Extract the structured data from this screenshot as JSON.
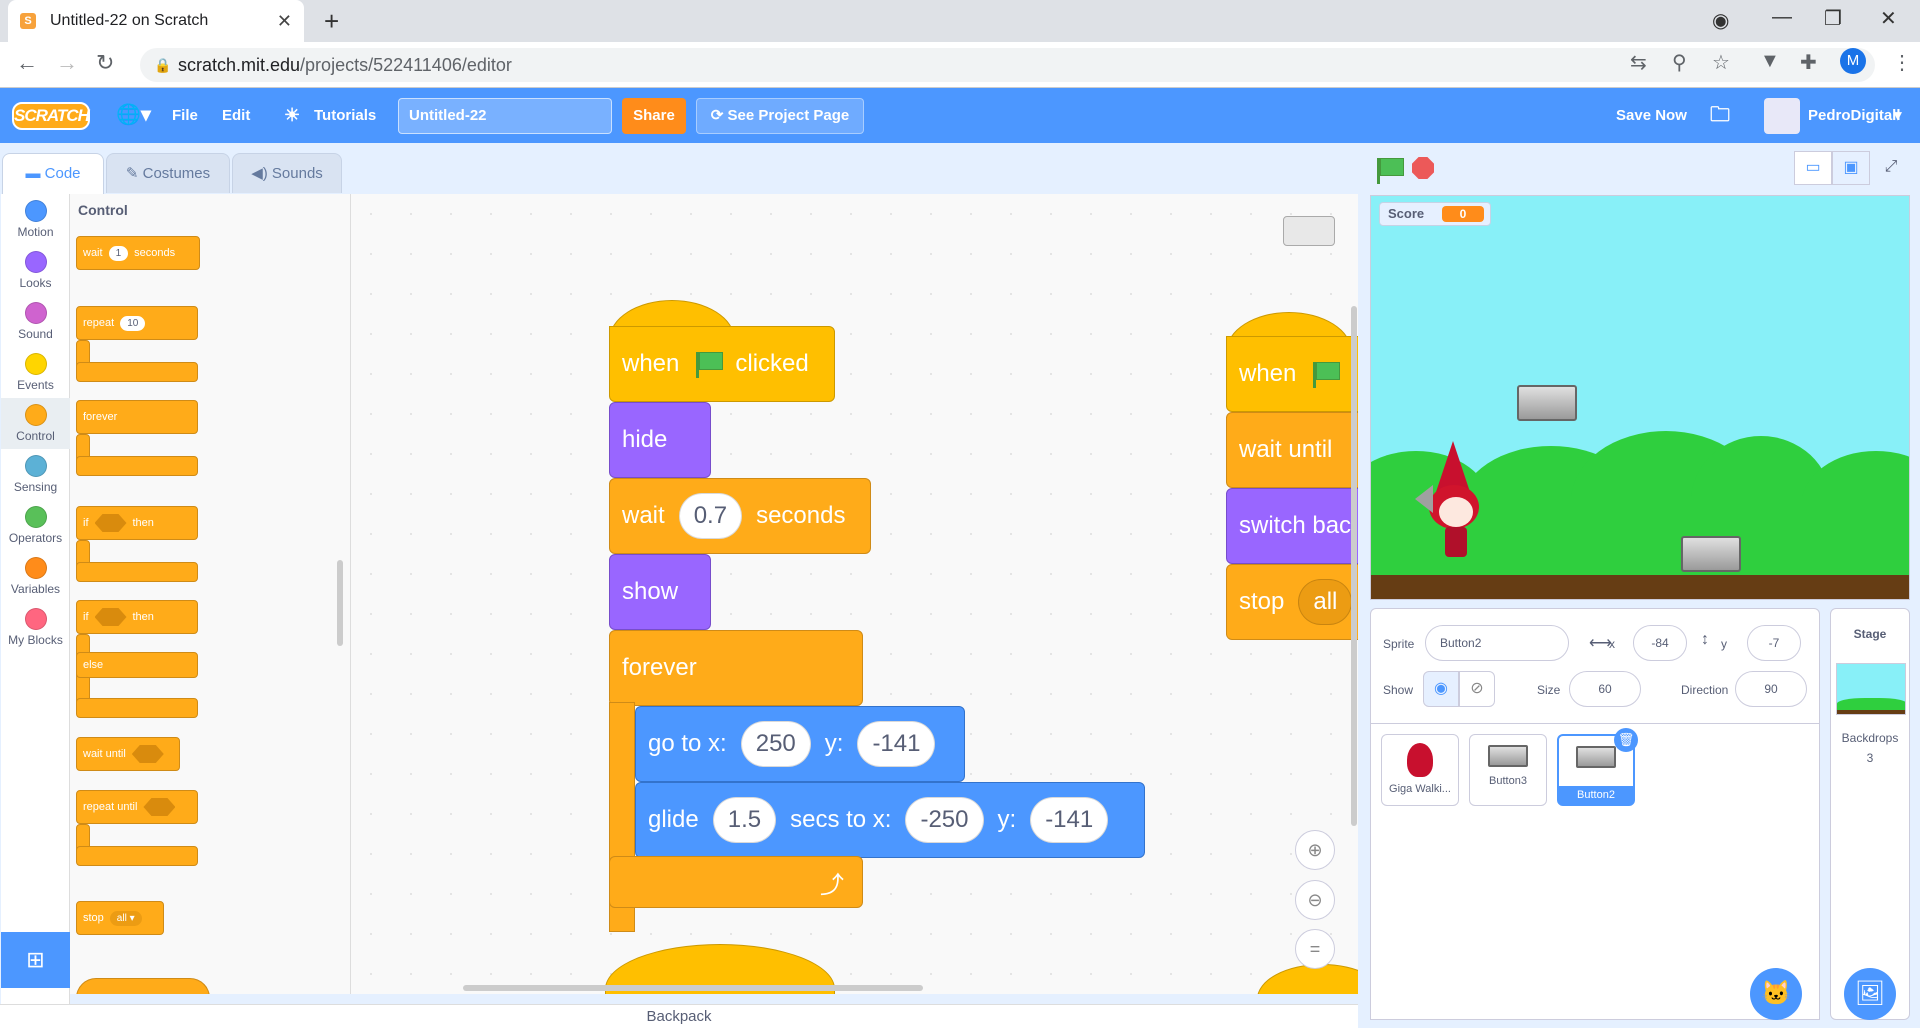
{
  "browser": {
    "tab_title": "Untitled-22 on Scratch",
    "url_host": "scratch.mit.edu",
    "url_path": "/projects/522411406/editor",
    "profile_initial": "M"
  },
  "menu": {
    "logo": "SCRATCH",
    "file": "File",
    "edit": "Edit",
    "tutorials": "Tutorials",
    "project_title": "Untitled-22",
    "share": "Share",
    "see_project_page": "See Project Page",
    "save_now": "Save Now",
    "username": "PedroDigitall"
  },
  "editor_tabs": {
    "code": "Code",
    "costumes": "Costumes",
    "sounds": "Sounds"
  },
  "categories": [
    {
      "label": "Motion",
      "color": "#4c97ff"
    },
    {
      "label": "Looks",
      "color": "#9966ff"
    },
    {
      "label": "Sound",
      "color": "#cf63cf"
    },
    {
      "label": "Events",
      "color": "#ffd500"
    },
    {
      "label": "Control",
      "color": "#ffab19"
    },
    {
      "label": "Sensing",
      "color": "#5cb1d6"
    },
    {
      "label": "Operators",
      "color": "#59c059"
    },
    {
      "label": "Variables",
      "color": "#ff8c1a"
    },
    {
      "label": "My Blocks",
      "color": "#ff6680"
    }
  ],
  "palette": {
    "header": "Control",
    "wait": "wait",
    "wait_val": "1",
    "seconds": "seconds",
    "repeat": "repeat",
    "repeat_val": "10",
    "forever": "forever",
    "if": "if",
    "then": "then",
    "else": "else",
    "wait_until": "wait until",
    "repeat_until": "repeat until",
    "stop": "stop",
    "stop_val": "all ▾"
  },
  "script": {
    "when": "when",
    "clicked": "clicked",
    "hide": "hide",
    "wait": "wait",
    "wait_val": "0.7",
    "seconds": "seconds",
    "show": "show",
    "forever": "forever",
    "goto": "go to x:",
    "goto_x": "250",
    "y": "y:",
    "goto_y": "-141",
    "glide": "glide",
    "glide_secs": "1.5",
    "secs_to_x": "secs to x:",
    "glide_x": "-250",
    "glide_y": "-141",
    "s2_when": "when",
    "s2_wait_until": "wait until",
    "s2_switch": "switch bac",
    "s2_stop": "stop",
    "s2_all": "all"
  },
  "backpack": "Backpack",
  "stage": {
    "monitor_label": "Score",
    "monitor_value": "0"
  },
  "sprite_info": {
    "sprite_label": "Sprite",
    "sprite_name": "Button2",
    "x_label": "x",
    "x": "-84",
    "y_label": "y",
    "y": "-7",
    "show_label": "Show",
    "size_label": "Size",
    "size": "60",
    "direction_label": "Direction",
    "direction": "90"
  },
  "sprites": [
    "Giga Walki...",
    "Button3",
    "Button2"
  ],
  "stage_pane": {
    "title": "Stage",
    "backdrops_label": "Backdrops",
    "backdrops_count": "3"
  }
}
